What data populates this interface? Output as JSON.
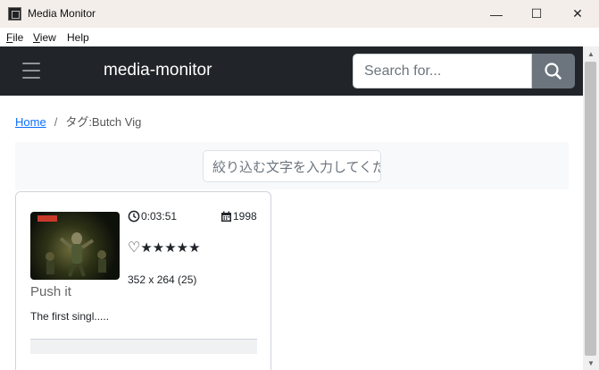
{
  "window": {
    "title": "Media Monitor",
    "minimize_glyph": "—",
    "maximize_glyph": "☐",
    "close_glyph": "✕"
  },
  "menu": {
    "file": {
      "mnemonic": "F",
      "rest": "ile"
    },
    "view": {
      "mnemonic": "V",
      "rest": "iew"
    },
    "help": {
      "label": "Help"
    }
  },
  "navbar": {
    "brand": "media-monitor",
    "search_placeholder": "Search for..."
  },
  "breadcrumb": {
    "home": "Home",
    "separator": "/",
    "current": "タグ:Butch Vig"
  },
  "filter": {
    "placeholder": "絞り込む文字を入力してくだ"
  },
  "card": {
    "duration": "0:03:51",
    "year": "1998",
    "rating_stars": "★★★★★",
    "favorite": "♡",
    "resolution": "352 x 264 (25)",
    "title": "Push it",
    "description": "The first singl....."
  },
  "scrollbar": {
    "up_glyph": "▲",
    "down_glyph": "▼"
  },
  "colors": {
    "navbar_bg": "#212529",
    "link": "#0d6efd",
    "search_button": "#6c757d"
  }
}
